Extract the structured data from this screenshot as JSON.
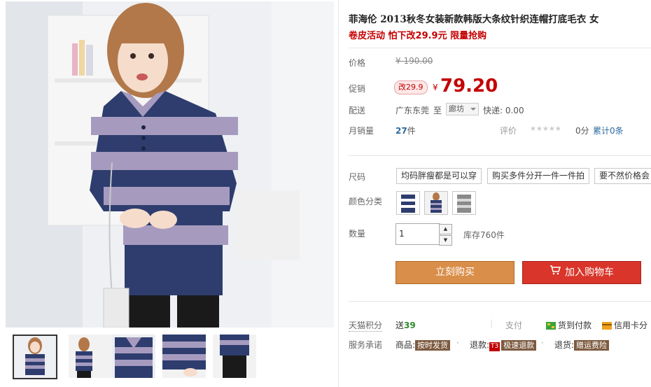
{
  "product": {
    "title": "菲海伦 2013秋冬女装新款韩版大条纹针织连帽打底毛衣 女",
    "subtitle": "卷皮活动 怕下改29.9元 限量抢购"
  },
  "price": {
    "label": "价格",
    "original": "¥ 190.00",
    "promo_label": "促销",
    "promo_badge": "改29.9",
    "currency": "¥",
    "current": "79.20"
  },
  "shipping": {
    "label": "配送",
    "from": "广东东莞",
    "to_text": "至",
    "destination": "廊坊",
    "express": "快递: 0.00"
  },
  "sales": {
    "label": "月销量",
    "count": "27",
    "unit": "件",
    "eval_label": "评价",
    "stars": "★★★★★",
    "score": "0分",
    "cumulative": "累计0条"
  },
  "options": {
    "size_label": "尺码",
    "sizes": [
      "均码胖瘦都是可以穿",
      "购买多件分开一件一件拍",
      "要不然价格会"
    ],
    "color_label": "颜色分类",
    "quantity_label": "数量",
    "quantity_value": "1",
    "qty_up": "▲",
    "qty_down": "▼",
    "stock": "库存760件"
  },
  "actions": {
    "buy_now": "立刻购买",
    "add_cart": "加入购物车"
  },
  "services": {
    "points_label": "天猫积分",
    "points_prefix": "送",
    "points_value": "39",
    "pay_label": "支付",
    "cod": "货到付款",
    "credit": "信用卡分",
    "promise_label": "服务承诺",
    "goods_label": "商品:",
    "goods_tag": "按时发货",
    "refund_label": "退款:",
    "refund_t3": "T3",
    "refund_tag": "极速退款",
    "return_label": "退货:",
    "return_tag": "赠运费险"
  },
  "colors": {
    "accent_red": "#c40000",
    "buy_orange": "#d98e49",
    "cart_red": "#d9352a",
    "link_blue": "#2d6aa0"
  }
}
